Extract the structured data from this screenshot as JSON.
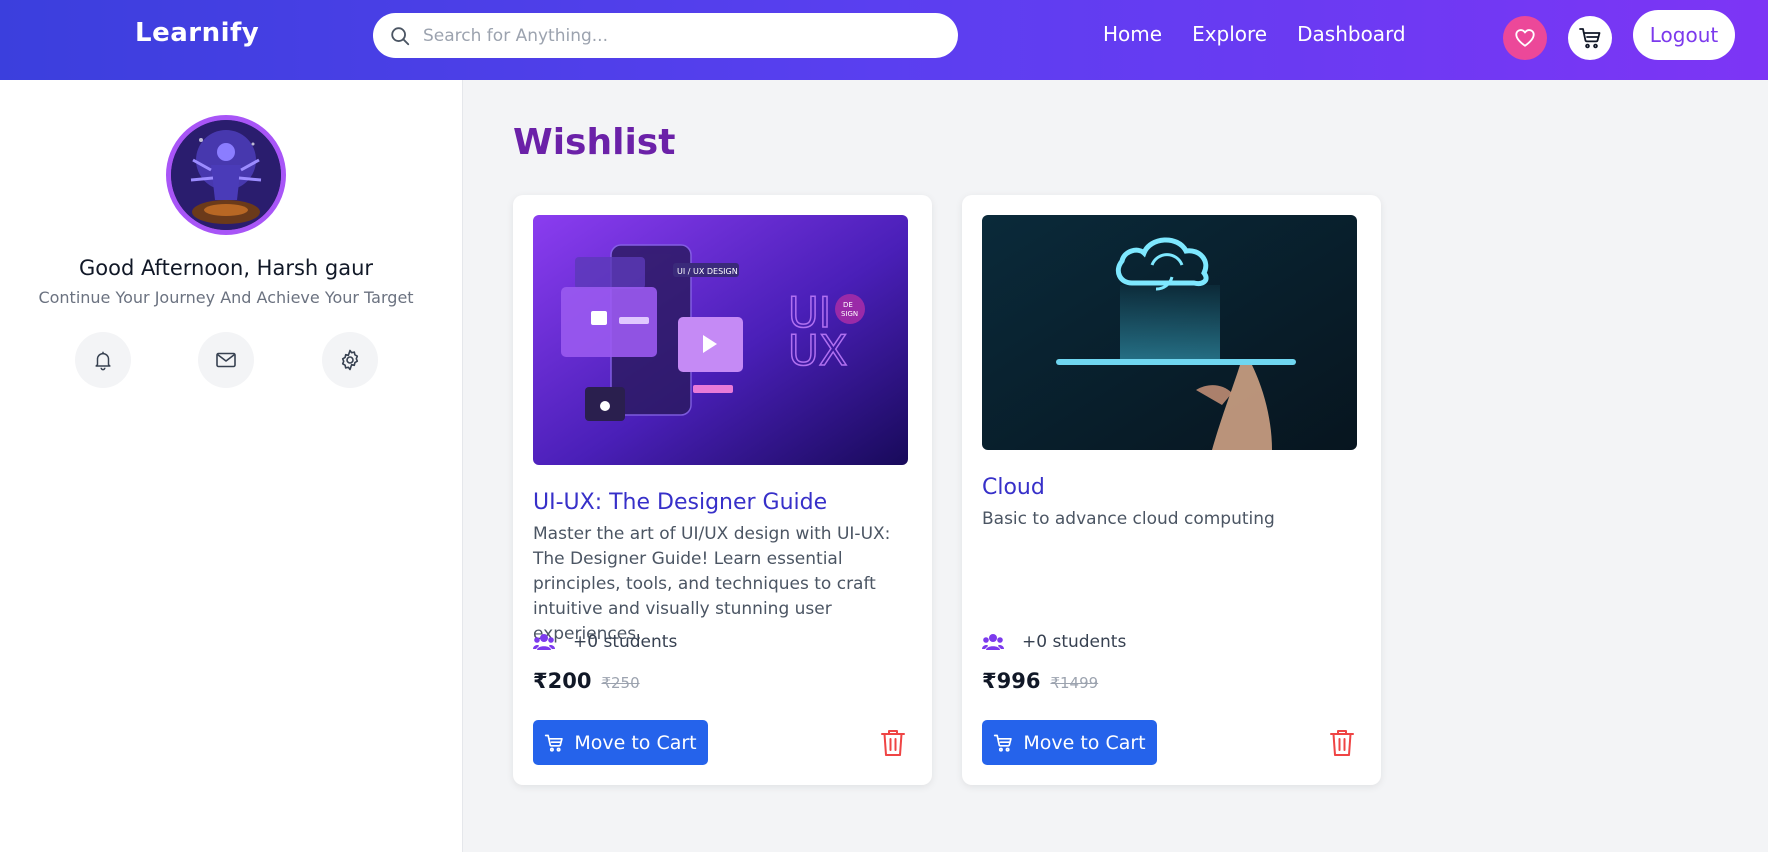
{
  "header": {
    "brand": "Learnify",
    "search_placeholder": "Search for Anything...",
    "nav": [
      "Home",
      "Explore",
      "Dashboard"
    ],
    "logout_label": "Logout",
    "wishlist_icon": "heart-icon",
    "cart_icon": "cart-icon"
  },
  "sidebar": {
    "greeting": "Good Afternoon, Harsh gaur",
    "subtitle": "Continue Your Journey And Achieve Your Target",
    "actions": [
      "bell-icon",
      "mail-icon",
      "gear-icon"
    ]
  },
  "main": {
    "title": "Wishlist",
    "cards": [
      {
        "title": "UI-UX: The Designer Guide",
        "description": "Master the art of UI/UX design with UI-UX: The Designer Guide! Learn essential principles, tools, and techniques to craft intuitive and visually stunning user experiences.",
        "students": "+0 students",
        "price": "₹200",
        "original_price": "₹250",
        "button_label": "Move to Cart",
        "thumb_text": {
          "label": "UI / UX DESIGN",
          "big_ui": "UI",
          "big_ux": "UX",
          "badge_top": "DE",
          "badge_bottom": "SIGN"
        }
      },
      {
        "title": "Cloud",
        "description": "Basic to advance cloud computing",
        "students": "+0 students",
        "price": "₹996",
        "original_price": "₹1499",
        "button_label": "Move to Cart"
      }
    ]
  },
  "colors": {
    "header_gradient_start": "#3b3fdd",
    "header_gradient_end": "#7d35f5",
    "title_purple": "#6b21a8",
    "card_title_blue": "#3730c9",
    "button_blue": "#2563eb",
    "trash_red": "#ef4444",
    "wishlist_pink": "#ec4899"
  }
}
